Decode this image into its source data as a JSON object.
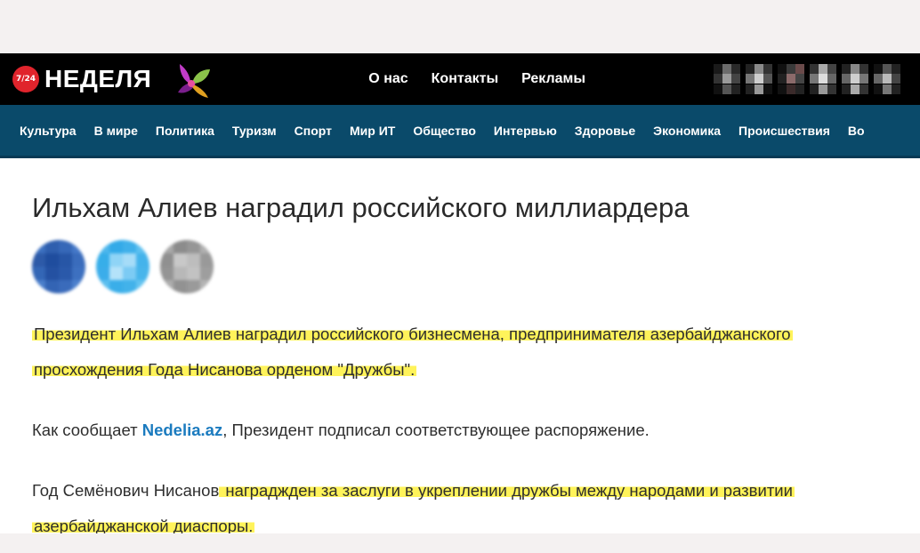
{
  "header": {
    "badge": "7/24",
    "brand": "НЕДЕЛЯ",
    "top_nav": [
      "О нас",
      "Контакты",
      "Рекламы"
    ]
  },
  "categories": [
    "Культура",
    "В мире",
    "Политика",
    "Туризм",
    "Спорт",
    "Мир ИТ",
    "Общество",
    "Интервью",
    "Здоровье",
    "Экономика",
    "Происшествия",
    "Во"
  ],
  "article": {
    "title": "Ильхам Алиев наградил российского миллиардера",
    "p1_line1": "Президент Ильхам Алиев наградил российского бизнесмена, предпринимателя азербайджанского",
    "p1_line2": "просхождения Года Нисанова орденом \"Дружбы\".",
    "p2_before": "Как сообщает ",
    "p2_link": "Nedelia.az",
    "p2_after": ", Президент подписал соответствующее распоряжение.",
    "p3_plain": "Год Семёнович Нисанов",
    "p3_hl_line1": " награджден за заслуги в укреплении дружбы между народами и развитии",
    "p3_hl_line2": "азербайджанской диаспоры."
  },
  "share_buttons": [
    "facebook-icon",
    "telegram-icon",
    "more-icon"
  ],
  "colors": {
    "topbar": "#000000",
    "catnav": "#0a4a6a",
    "badge": "#e0242c",
    "highlight": "#fff35a",
    "link": "#1b7bbf"
  }
}
